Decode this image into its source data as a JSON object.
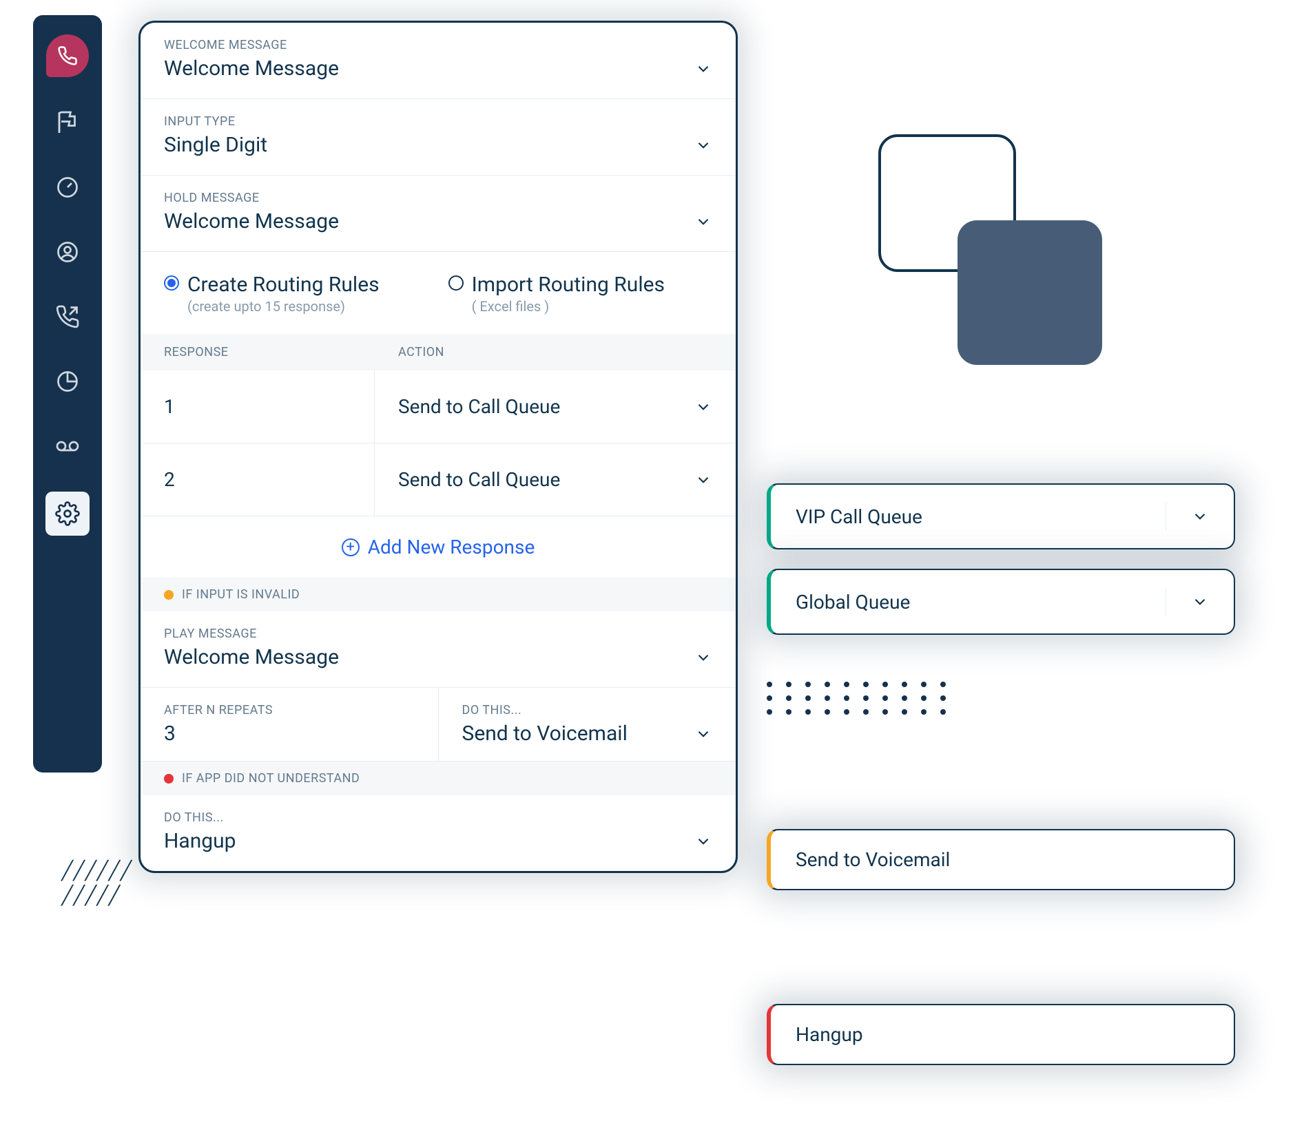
{
  "sidebar": {
    "items": [
      {
        "name": "phone-icon"
      },
      {
        "name": "flag-icon"
      },
      {
        "name": "gauge-icon"
      },
      {
        "name": "user-icon"
      },
      {
        "name": "phone-forward-icon"
      },
      {
        "name": "pie-chart-icon"
      },
      {
        "name": "voicemail-icon"
      },
      {
        "name": "gear-icon"
      }
    ]
  },
  "fields": {
    "welcome_label": "Welcome Message",
    "welcome_value": "Welcome Message",
    "input_type_label": "Input Type",
    "input_type_value": "Single Digit",
    "hold_label": "Hold Message",
    "hold_value": "Welcome Message"
  },
  "routing": {
    "create_label": "Create Routing Rules",
    "create_sub": "(create upto 15 response)",
    "import_label": "Import Routing Rules",
    "import_sub": "( Excel files )",
    "selected": "create"
  },
  "table": {
    "col_response": "Response",
    "col_action": "Action",
    "rows": [
      {
        "response": "1",
        "action": "Send to Call Queue",
        "target": "VIP Call Queue"
      },
      {
        "response": "2",
        "action": "Send to Call Queue",
        "target": "Global Queue"
      }
    ],
    "add_label": "Add New Response"
  },
  "invalid": {
    "section_label": "If Input is Invalid",
    "play_label": "Play Message",
    "play_value": "Welcome Message",
    "repeats_label": "After N Repeats",
    "repeats_value": "3",
    "do_label": "Do this...",
    "do_value": "Send to Voicemail",
    "target": "Send to Voicemail"
  },
  "noresponse": {
    "section_label": "If App Did Not Understand",
    "do_label": "Do this...",
    "do_value": "Hangup",
    "target": "Hangup"
  }
}
